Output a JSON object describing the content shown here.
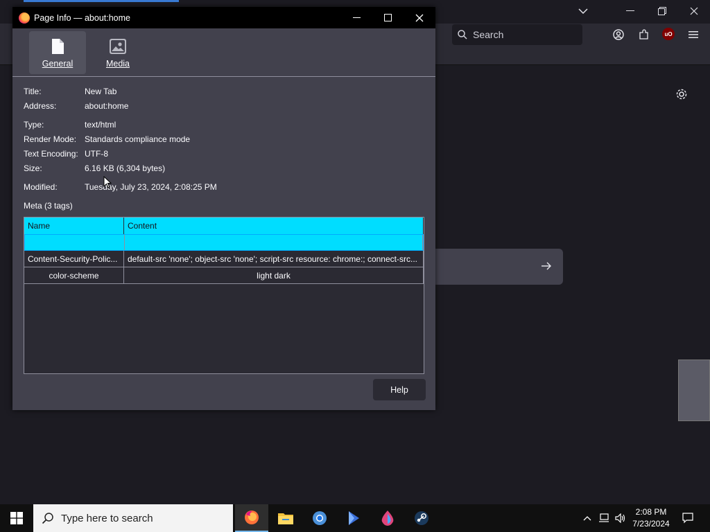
{
  "dialog": {
    "title": "Page Info — about:home",
    "tabs": [
      {
        "label": "General",
        "active": true,
        "icon": "document-icon"
      },
      {
        "label": "Media",
        "active": false,
        "icon": "image-icon"
      }
    ]
  },
  "general": {
    "title_label": "Title:",
    "title_value": "New Tab",
    "address_label": "Address:",
    "address_value": "about:home",
    "type_label": "Type:",
    "type_value": "text/html",
    "render_label": "Render Mode:",
    "render_value": "Standards compliance mode",
    "encoding_label": "Text Encoding:",
    "encoding_value": "UTF-8",
    "size_label": "Size:",
    "size_value": "6.16 KB (6,304 bytes)",
    "modified_label": "Modified:",
    "modified_value": "Tuesday, July 23, 2024, 2:08:25 PM"
  },
  "meta": {
    "heading": "Meta (3 tags)",
    "columns": [
      "Name",
      "Content"
    ],
    "rows": [
      {
        "name": "",
        "content": "",
        "selected": true
      },
      {
        "name": "Content-Security-Polic...",
        "content": "default-src 'none'; object-src 'none'; script-src resource: chrome:; connect-src..."
      },
      {
        "name": "color-scheme",
        "content": "light dark"
      }
    ]
  },
  "help_label": "Help",
  "browser": {
    "search_placeholder": "Search",
    "ublock_label": "uO"
  },
  "taskbar": {
    "search_placeholder": "Type here to search",
    "time": "2:08 PM",
    "date": "7/23/2024"
  }
}
